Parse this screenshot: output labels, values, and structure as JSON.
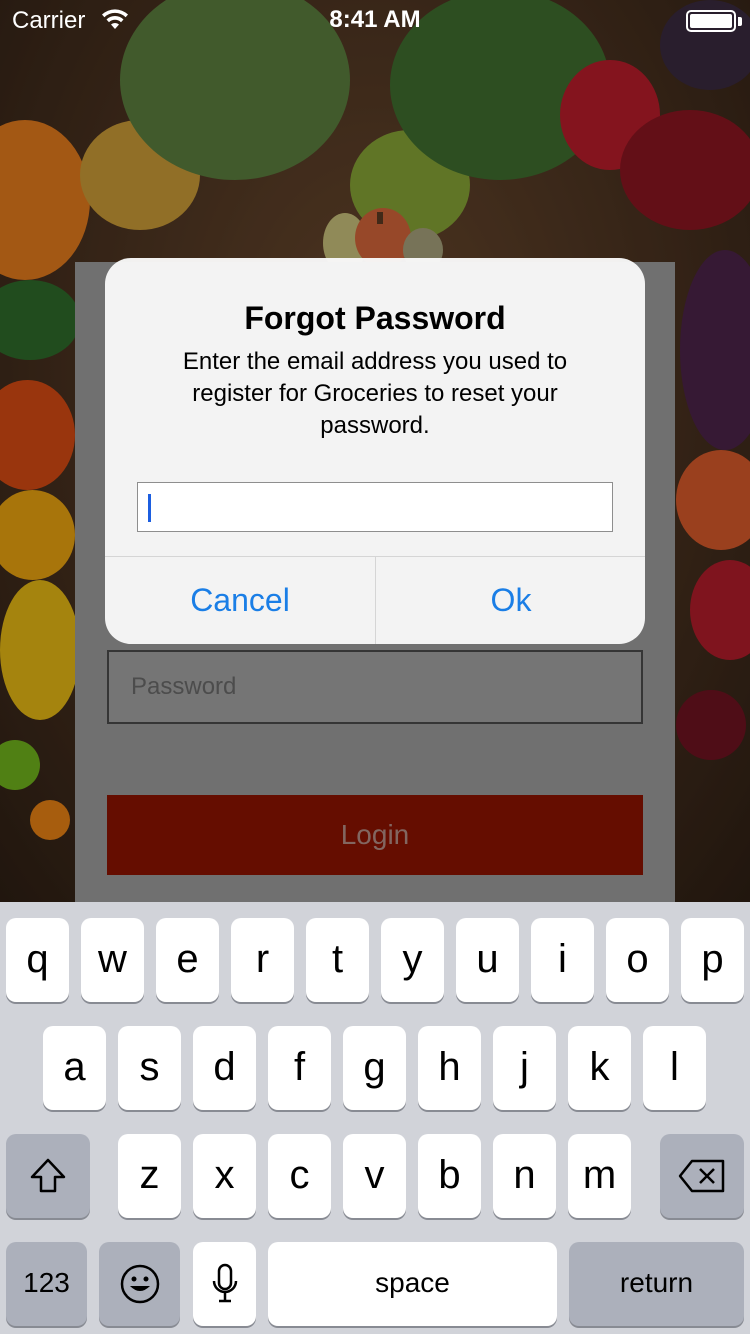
{
  "status_bar": {
    "carrier": "Carrier",
    "time": "8:41 AM"
  },
  "login": {
    "password_placeholder": "Password",
    "login_label": "Login"
  },
  "alert": {
    "title": "Forgot Password",
    "message": "Enter the email address you used to register for Groceries to reset your password.",
    "email_value": "",
    "cancel_label": "Cancel",
    "ok_label": "Ok"
  },
  "keyboard": {
    "row1": [
      "q",
      "w",
      "e",
      "r",
      "t",
      "y",
      "u",
      "i",
      "o",
      "p"
    ],
    "row2": [
      "a",
      "s",
      "d",
      "f",
      "g",
      "h",
      "j",
      "k",
      "l"
    ],
    "row3": [
      "z",
      "x",
      "c",
      "v",
      "b",
      "n",
      "m"
    ],
    "numbers_label": "123",
    "space_label": "space",
    "return_label": "return",
    "shift_icon": "shift-icon",
    "delete_icon": "delete-icon",
    "emoji_icon": "emoji-icon",
    "mic_icon": "microphone-icon"
  },
  "colors": {
    "accent": "#1a7ee6",
    "login_button": "#8c1300"
  }
}
